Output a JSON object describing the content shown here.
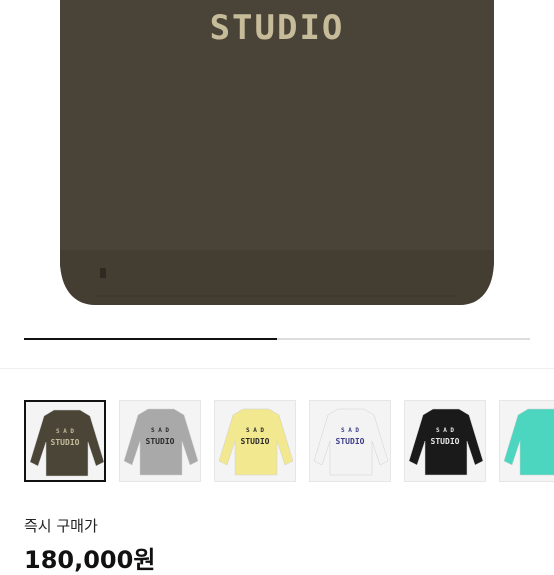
{
  "product": {
    "hero_print": "STUDIO",
    "hero_color": "#4a4438",
    "print_color": "#c7bc9a",
    "gallery_progress": 0.5
  },
  "thumbnails": [
    {
      "name": "brown",
      "color": "#4b4538",
      "print": "S A D\nSTUDIO",
      "print_color": "#c7bc9a",
      "selected": true
    },
    {
      "name": "gray",
      "color": "#a9a9a9",
      "print": "S A D\nSTUDIO",
      "print_color": "#2a2a2a",
      "selected": false
    },
    {
      "name": "yellow",
      "color": "#f2e88f",
      "print": "S A D\nSTUDIO",
      "print_color": "#2a2a2a",
      "selected": false
    },
    {
      "name": "white",
      "color": "#f3f3f3",
      "print": "S A D\nSTUDIO",
      "print_color": "#3d3d8a",
      "selected": false
    },
    {
      "name": "black",
      "color": "#1a1a1a",
      "print": "S A D\nSTUDIO",
      "print_color": "#e8e8e8",
      "selected": false
    },
    {
      "name": "mint",
      "color": "#4cd6c0",
      "print": "",
      "print_color": "#ffffff",
      "selected": false
    }
  ],
  "purchase": {
    "label": "즉시 구매가",
    "price": "180,000원"
  }
}
